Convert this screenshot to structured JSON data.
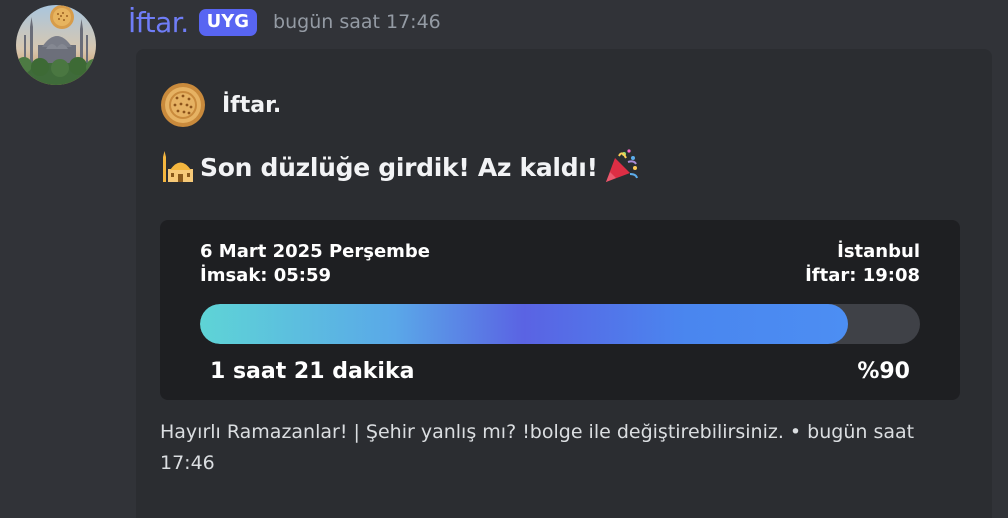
{
  "message": {
    "avatar_icon": "mosque-skyline-avatar",
    "username": "İftar.",
    "app_badge": "UYG",
    "timestamp": "bugün saat 17:46"
  },
  "embed": {
    "author": {
      "icon": "flatbread-icon",
      "name": "İftar."
    },
    "title": {
      "leading_icon": "mosque-emoji-icon",
      "text": "Son düzlüğe girdik! Az kaldı!",
      "trailing_icon": "party-popper-emoji-icon"
    },
    "card": {
      "date": "6 Mart 2025 Perşembe",
      "imsak": "İmsak: 05:59",
      "city": "İstanbul",
      "iftar": "İftar: 19:08",
      "progress_fraction": 0.9,
      "remaining": "1 saat 21 dakika",
      "percent_label": "%90"
    },
    "footer": {
      "text": "Hayırlı Ramazanlar! | Şehir yanlış mı? !bolge ile değiştirebilirsiniz.",
      "separator": " • ",
      "timestamp": "bugün saat 17:46"
    }
  },
  "colors": {
    "background": "#313338",
    "embed_background": "#2b2d31",
    "card_background": "#1e1f22",
    "username": "#6f7df7",
    "badge": "#5865f2",
    "progress_track": "#3f4147"
  }
}
